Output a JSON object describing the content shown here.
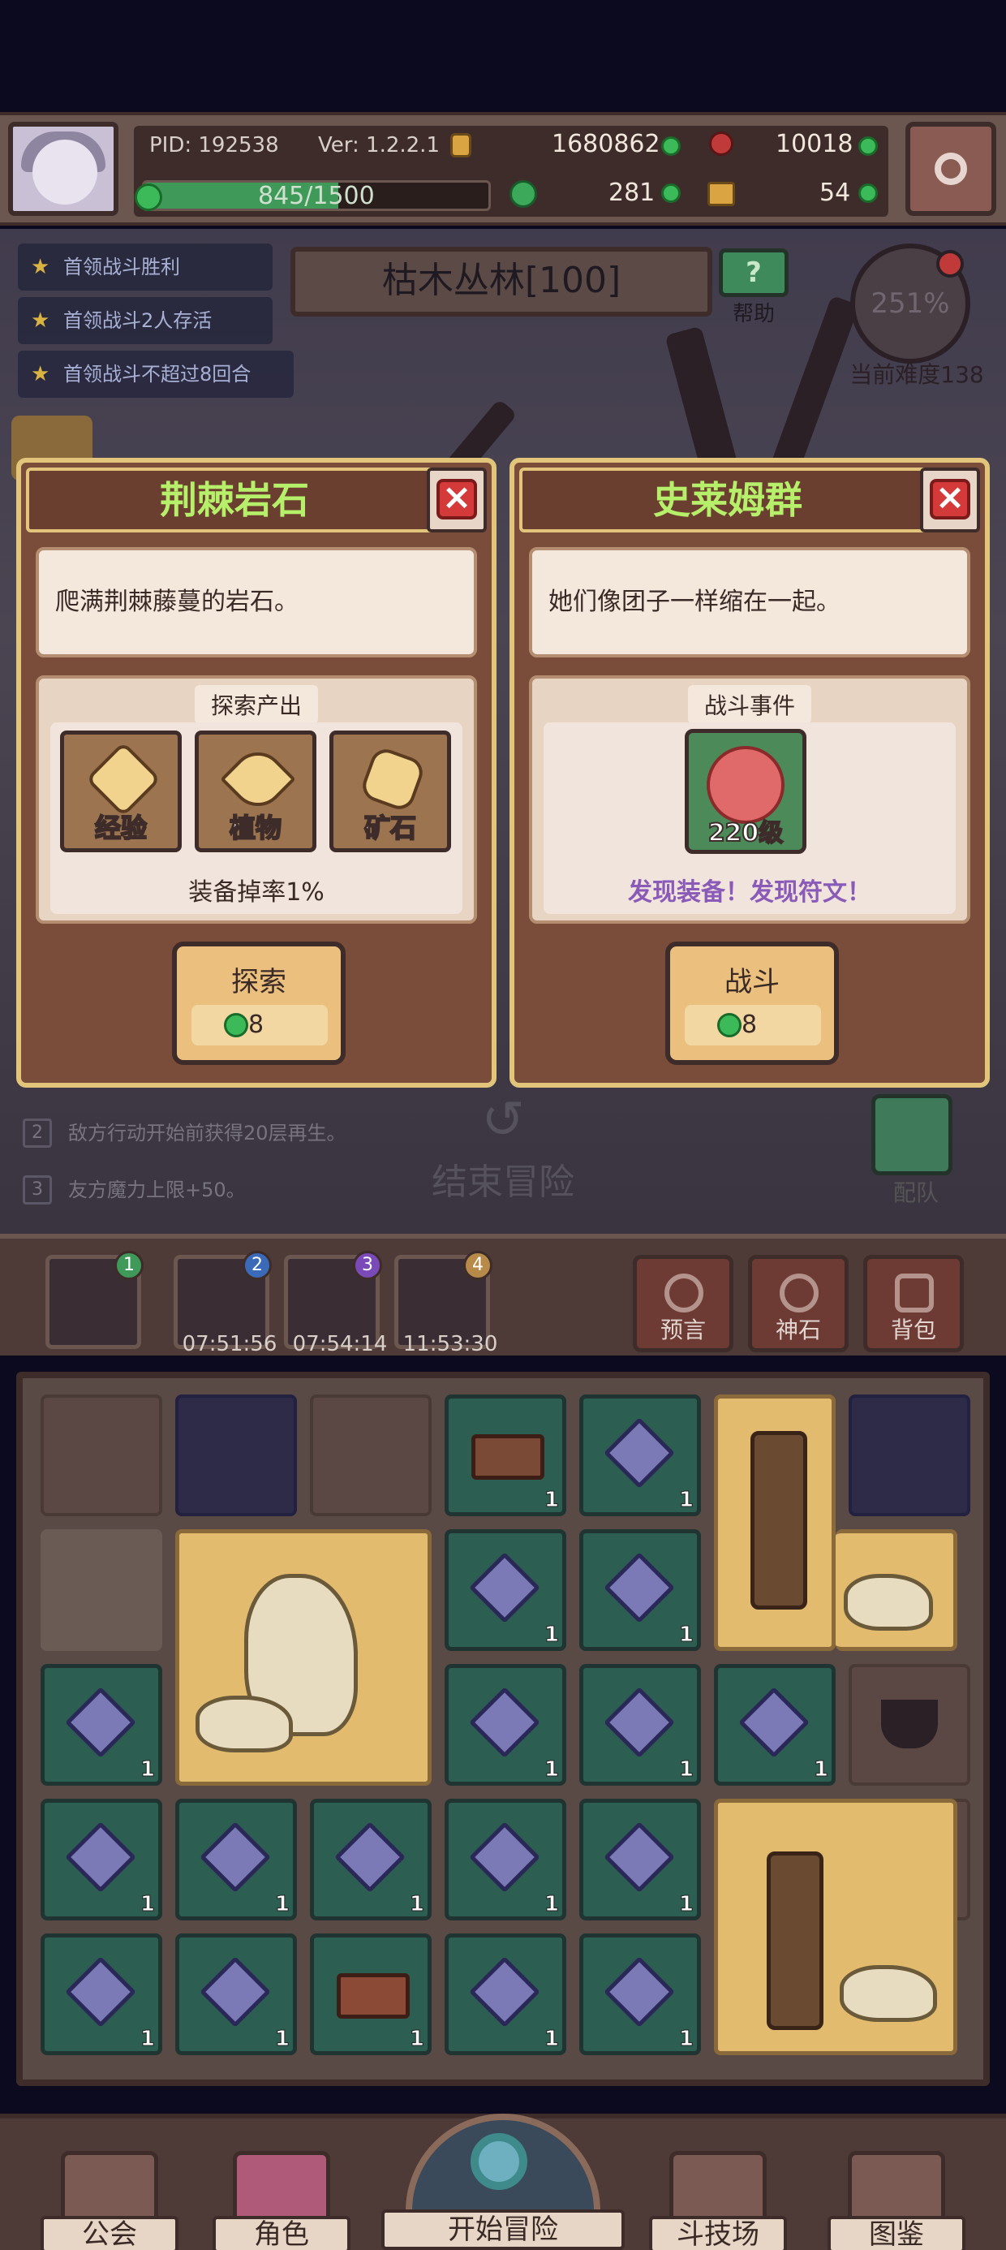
{
  "top_bar": {
    "pid": "PID: 192538",
    "version": "Ver: 1.2.2.1",
    "gold": "1680862",
    "apples": "10018",
    "energy": "845/1500",
    "energy_fraction": 0.563,
    "clovers": "281",
    "keys": "54"
  },
  "quests": [
    {
      "text": "首领战斗胜利"
    },
    {
      "text": "首领战斗2人存活"
    },
    {
      "text": "首领战斗不超过8回合"
    }
  ],
  "area": {
    "name": "枯木丛林[100]",
    "help_label": "帮助",
    "help_icon": "?",
    "difficulty_percent": "251%",
    "difficulty_label": "当前难度138"
  },
  "card_left": {
    "title": "荆棘岩石",
    "close_label": "×",
    "description": "爬满荆棘藤蔓的岩石。",
    "section_title": "探索产出",
    "products": [
      {
        "label": "经验",
        "icon": "experience-icon"
      },
      {
        "label": "植物",
        "icon": "leaf-icon"
      },
      {
        "label": "矿石",
        "icon": "ore-icon"
      }
    ],
    "drop_rate": "装备掉率1%",
    "action_label": "探索",
    "cost": "8"
  },
  "card_right": {
    "title": "史莱姆群",
    "close_label": "×",
    "description": "她们像团子一样缩在一起。",
    "section_title": "战斗事件",
    "monster_level": "220级",
    "found_text": "发现装备！发现符文！",
    "action_label": "战斗",
    "cost": "8"
  },
  "effects": [
    {
      "n": "2",
      "text": "敌方行动开始前获得20层再生。"
    },
    {
      "n": "3",
      "text": "友方魔力上限+50。"
    }
  ],
  "end_adventure": "结束冒险",
  "team_label": "配队",
  "slots": [
    {
      "badge": "1",
      "time": "",
      "badge_color": "#3f9a5a"
    },
    {
      "badge": "2",
      "time": "07:51:56",
      "badge_color": "#3a6ab8"
    },
    {
      "badge": "3",
      "time": "07:54:14",
      "badge_color": "#7a4ab8"
    },
    {
      "badge": "4",
      "time": "11:53:30",
      "badge_color": "#b88a4a"
    }
  ],
  "tools": [
    {
      "label": "预言",
      "icon": "crystal-ball-icon"
    },
    {
      "label": "神石",
      "icon": "god-stone-icon"
    },
    {
      "label": "背包",
      "icon": "backpack-icon"
    }
  ],
  "grid_count": "1",
  "bottom_nav": {
    "guild": "公会",
    "character": "角色",
    "start": "开始冒险",
    "arena": "斗技场",
    "codex": "图鉴"
  },
  "colors": {
    "accent_green": "#b6f06a",
    "close_red": "#d43a3a",
    "found_purple": "#8a5ab8"
  }
}
